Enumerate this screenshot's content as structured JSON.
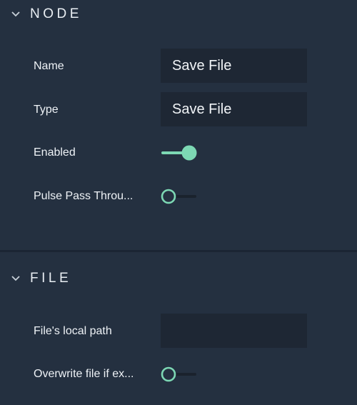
{
  "node_section": {
    "title": "NODE",
    "chevron_icon": "chevron-down-icon",
    "name_label": "Name",
    "name_value": "Save File",
    "type_label": "Type",
    "type_value": "Save File",
    "enabled_label": "Enabled",
    "enabled_on": true,
    "pulse_label": "Pulse Pass Throu...",
    "pulse_on": false
  },
  "file_section": {
    "title": "FILE",
    "chevron_icon": "chevron-down-icon",
    "path_label": "File's local path",
    "path_value": "",
    "overwrite_label": "Overwrite file if ex...",
    "overwrite_on": false
  },
  "colors": {
    "background": "#243040",
    "field": "#1e2734",
    "accent": "#7dd8b4",
    "track_off": "#1a222d"
  }
}
